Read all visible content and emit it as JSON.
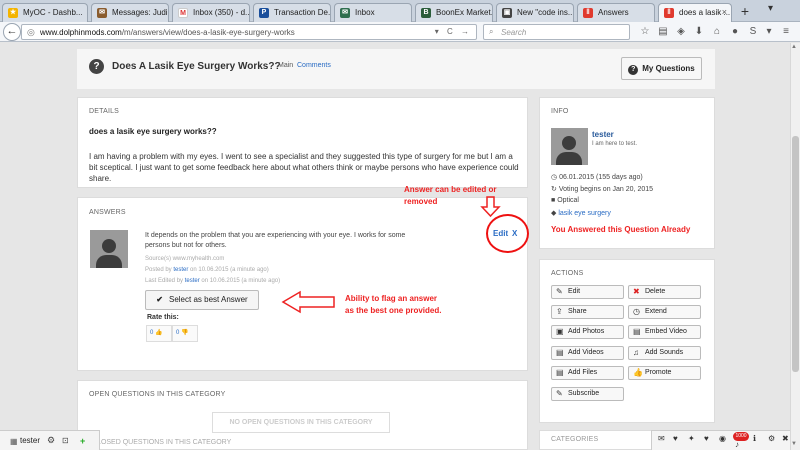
{
  "browser": {
    "tabs": [
      {
        "label": "MyOC - Dashb...",
        "color": "#f4b400",
        "glyph": "★"
      },
      {
        "label": "Messages: Judi...",
        "color": "#8a5c2e",
        "glyph": "✉"
      },
      {
        "label": "Inbox (350) - d...",
        "color": "#ffffff",
        "glyph": "M"
      },
      {
        "label": "Transaction De...",
        "color": "#1a4f9c",
        "glyph": "P"
      },
      {
        "label": "Inbox",
        "color": "#2f6f4f",
        "glyph": "✉"
      },
      {
        "label": "BoonEx Market...",
        "color": "#2b5d3a",
        "glyph": "B"
      },
      {
        "label": "New \"code ins...",
        "color": "#444444",
        "glyph": "▣"
      },
      {
        "label": "Answers",
        "color": "#e03a2e",
        "glyph": "‖"
      },
      {
        "label": "does a lasik ...",
        "color": "#e03a2e",
        "glyph": "‖"
      }
    ],
    "newtab": "+",
    "tab_close": "×",
    "url_domain": "www.dolphinmods.com",
    "url_path": "/m/answers/view/does-a-lasik-eye-surgery-works",
    "search_placeholder": "Search"
  },
  "question": {
    "title": "Does A Lasik Eye Surgery Works??",
    "tab_main": "Main",
    "tab_comments": "Comments",
    "my_questions": "My Questions"
  },
  "details": {
    "heading": "DETAILS",
    "question": "does a lasik eye surgery works??",
    "body": "I am having a problem with my eyes. I went to see a specialist and they suggested this type of surgery for me but I am a bit sceptical. I just want to get some feedback here about what others think or maybe persons who have experience could share."
  },
  "answers": {
    "heading": "ANSWERS",
    "text": "It depends on the problem that you are experiencing with your eye. I works for some persons but not for others.",
    "source": "Source(s) www.myhealth.com",
    "posted_prefix": "Posted by",
    "posted_user": "tester",
    "posted_suffix": "on 10.06.2015 (a minute ago)",
    "edited_prefix": "Last Edited by",
    "edited_user": "tester",
    "edited_suffix": "on 10.06.2015 (a minute ago)",
    "best_button": "Select as best Answer",
    "rate_label": "Rate this:",
    "up_count": "0",
    "down_count": "0",
    "edit": "Edit",
    "delete": "X"
  },
  "annotations": {
    "edit_note_1": "Answer can be edited or",
    "edit_note_2": "removed",
    "best_note_1": "Ability to flag an answer",
    "best_note_2": "as the best one provided."
  },
  "open_questions": {
    "heading": "OPEN QUESTIONS IN THIS CATEGORY",
    "empty": "NO OPEN QUESTIONS IN THIS CATEGORY",
    "closed_heading": "CLOSED QUESTIONS IN THIS CATEGORY"
  },
  "info": {
    "heading": "INFO",
    "user": "tester",
    "bio": "I am here to test.",
    "date": "06.01.2015 (155 days ago)",
    "voting": "Voting begins on Jan 20, 2015",
    "category": "Optical",
    "tag": "lasik eye surgery",
    "answered": "You Answered this Question Already"
  },
  "actions": {
    "heading": "ACTIONS",
    "buttons": [
      {
        "label": "Edit",
        "icon": "✎"
      },
      {
        "label": "Delete",
        "icon": "✖"
      },
      {
        "label": "Share",
        "icon": "⇪"
      },
      {
        "label": "Extend",
        "icon": "◷"
      },
      {
        "label": "Add Photos",
        "icon": "▣"
      },
      {
        "label": "Embed Video",
        "icon": "▤"
      },
      {
        "label": "Add Videos",
        "icon": "▤"
      },
      {
        "label": "Add Sounds",
        "icon": "♫"
      },
      {
        "label": "Add Files",
        "icon": "▤"
      },
      {
        "label": "Promote",
        "icon": "👍"
      },
      {
        "label": "Subscribe",
        "icon": "✎"
      }
    ]
  },
  "categories": {
    "heading": "CATEGORIES"
  },
  "userbar": {
    "name": "tester"
  },
  "notifications": {
    "badge": "1000"
  }
}
